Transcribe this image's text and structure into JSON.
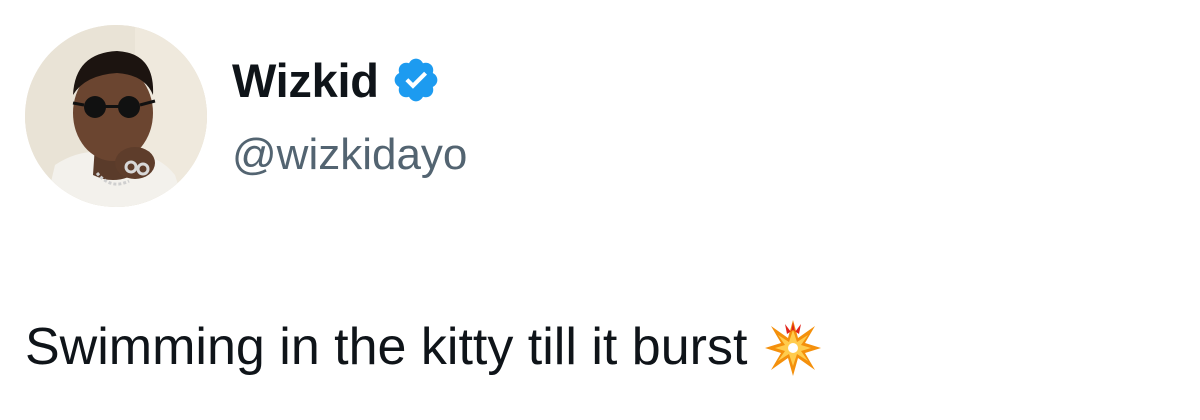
{
  "author": {
    "display_name": "Wizkid",
    "handle": "@wizkidayo",
    "verified": true,
    "verified_icon": "verified-badge-icon",
    "verified_color": "#1d9bf0"
  },
  "tweet": {
    "text": "Swimming in the kitty till it burst",
    "emoji": "💥",
    "emoji_icon": "collision-emoji-icon"
  },
  "colors": {
    "text_primary": "#0f1419",
    "text_secondary": "#536471",
    "background": "#ffffff"
  }
}
